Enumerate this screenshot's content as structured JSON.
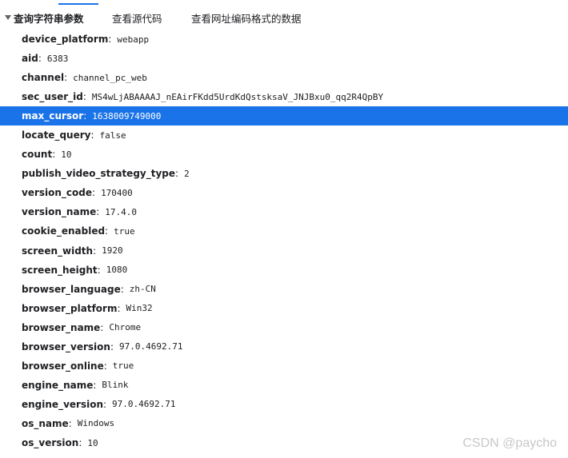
{
  "header": {
    "query_section": "查询字符串参数",
    "view_source": "查看源代码",
    "view_url_encoded": "查看网址编码格式的数据"
  },
  "params": [
    {
      "key": "device_platform",
      "value": "webapp"
    },
    {
      "key": "aid",
      "value": "6383"
    },
    {
      "key": "channel",
      "value": "channel_pc_web"
    },
    {
      "key": "sec_user_id",
      "value": "MS4wLjABAAAAJ_nEAirFKdd5UrdKdQstsksaV_JNJBxu0_qq2R4QpBY"
    },
    {
      "key": "max_cursor",
      "value": "1638009749000"
    },
    {
      "key": "locate_query",
      "value": "false"
    },
    {
      "key": "count",
      "value": "10"
    },
    {
      "key": "publish_video_strategy_type",
      "value": "2"
    },
    {
      "key": "version_code",
      "value": "170400"
    },
    {
      "key": "version_name",
      "value": "17.4.0"
    },
    {
      "key": "cookie_enabled",
      "value": "true"
    },
    {
      "key": "screen_width",
      "value": "1920"
    },
    {
      "key": "screen_height",
      "value": "1080"
    },
    {
      "key": "browser_language",
      "value": "zh-CN"
    },
    {
      "key": "browser_platform",
      "value": "Win32"
    },
    {
      "key": "browser_name",
      "value": "Chrome"
    },
    {
      "key": "browser_version",
      "value": "97.0.4692.71"
    },
    {
      "key": "browser_online",
      "value": "true"
    },
    {
      "key": "engine_name",
      "value": "Blink"
    },
    {
      "key": "engine_version",
      "value": "97.0.4692.71"
    },
    {
      "key": "os_name",
      "value": "Windows"
    },
    {
      "key": "os_version",
      "value": "10"
    }
  ],
  "selected_key": "max_cursor",
  "colors": {
    "selection": "#1a73e8",
    "tab_indicator": "#1a73e8"
  },
  "watermark": "CSDN @paycho"
}
